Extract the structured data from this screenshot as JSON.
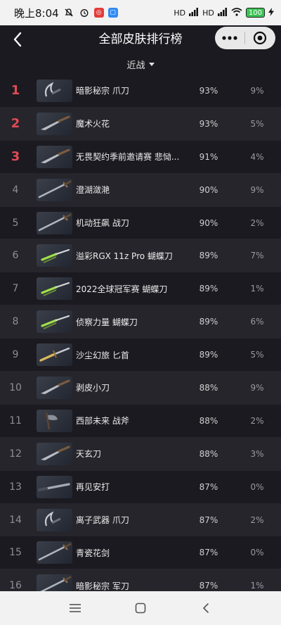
{
  "status_bar": {
    "time": "晚上8:04",
    "network_left": "HD",
    "network_right": "HD",
    "battery": "100"
  },
  "header": {
    "title": "全部皮肤排行榜"
  },
  "filter": {
    "selected": "近战"
  },
  "colors": {
    "background": "#1b1a21",
    "alt_row": "#26252c",
    "top_rank": "#e24a55",
    "capsule": "#e8e8e8"
  },
  "rows": [
    {
      "rank": "1",
      "name": "暗影秘宗 爪刀",
      "winrate": "93%",
      "pickrate": "9%",
      "icon": "claw-blade-icon",
      "top": true
    },
    {
      "rank": "2",
      "name": "魔术火花",
      "winrate": "93%",
      "pickrate": "5%",
      "icon": "knife-icon",
      "top": true
    },
    {
      "rank": "3",
      "name": "无畏契约季前邀请赛 悲恸...",
      "winrate": "91%",
      "pickrate": "4%",
      "icon": "knife-icon",
      "top": true
    },
    {
      "rank": "4",
      "name": "澄湖潋滟",
      "winrate": "90%",
      "pickrate": "9%",
      "icon": "sword-icon",
      "top": false
    },
    {
      "rank": "5",
      "name": "机动狂飙 战刀",
      "winrate": "90%",
      "pickrate": "2%",
      "icon": "sword-icon",
      "top": false
    },
    {
      "rank": "6",
      "name": "溢彩RGX 11z Pro 蝴蝶刀",
      "winrate": "89%",
      "pickrate": "7%",
      "icon": "butterfly-knife-icon",
      "top": false
    },
    {
      "rank": "7",
      "name": "2022全球冠军赛 蝴蝶刀",
      "winrate": "89%",
      "pickrate": "1%",
      "icon": "butterfly-knife-icon",
      "top": false
    },
    {
      "rank": "8",
      "name": "侦察力量 蝴蝶刀",
      "winrate": "89%",
      "pickrate": "6%",
      "icon": "butterfly-knife-icon",
      "top": false
    },
    {
      "rank": "9",
      "name": "沙尘幻旅 匕首",
      "winrate": "89%",
      "pickrate": "5%",
      "icon": "dagger-icon",
      "top": false
    },
    {
      "rank": "10",
      "name": "剥皮小刀",
      "winrate": "88%",
      "pickrate": "9%",
      "icon": "knife-icon",
      "top": false
    },
    {
      "rank": "11",
      "name": "西部未来 战斧",
      "winrate": "88%",
      "pickrate": "2%",
      "icon": "axe-icon",
      "top": false
    },
    {
      "rank": "12",
      "name": "天玄刀",
      "winrate": "88%",
      "pickrate": "3%",
      "icon": "knife-icon",
      "top": false
    },
    {
      "rank": "13",
      "name": "再见安打",
      "winrate": "87%",
      "pickrate": "0%",
      "icon": "bat-icon",
      "top": false
    },
    {
      "rank": "14",
      "name": "离子武器 爪刀",
      "winrate": "87%",
      "pickrate": "2%",
      "icon": "claw-blade-icon",
      "top": false
    },
    {
      "rank": "15",
      "name": "青瓷花剑",
      "winrate": "87%",
      "pickrate": "0%",
      "icon": "sword-icon",
      "top": false
    },
    {
      "rank": "16",
      "name": "暗影秘宗 军刀",
      "winrate": "87%",
      "pickrate": "1%",
      "icon": "sword-icon",
      "top": false
    }
  ]
}
